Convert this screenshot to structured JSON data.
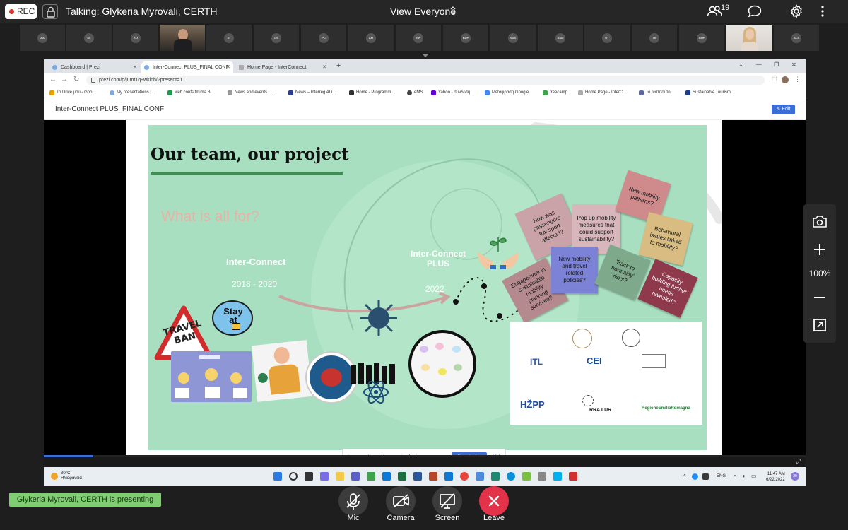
{
  "topbar": {
    "rec_label": "REC",
    "talking": "Talking: Glykeria Myrovali, CERTH",
    "view_mode": "View Everyone",
    "participant_count": "19"
  },
  "thumbnails": [
    {
      "initials": "AA"
    },
    {
      "initials": "KL"
    },
    {
      "initials": "KO"
    },
    {
      "initials": ""
    },
    {
      "initials": "JT"
    },
    {
      "initials": "DS"
    },
    {
      "initials": "PC"
    },
    {
      "initials": "AM"
    },
    {
      "initials": "GK"
    },
    {
      "initials": "BDP"
    },
    {
      "initials": "VDS"
    },
    {
      "initials": "ASM"
    },
    {
      "initials": "GT"
    },
    {
      "initials": "TM"
    },
    {
      "initials": "SMP"
    },
    {
      "initials": ""
    },
    {
      "initials": "ALS"
    }
  ],
  "browser": {
    "tabs": [
      {
        "label": "Dashboard | Prezi"
      },
      {
        "label": "Inter-Connect PLUS_FINAL CONF"
      },
      {
        "label": "Home Page - InterConnect"
      }
    ],
    "url": "prezi.com/p/jumt1q9wklnh/?present=1",
    "bookmarks": [
      "To Drive μου - Goo...",
      "My presentations |...",
      "web confs tmima B...",
      "News and events | I...",
      "News – Interreg AD...",
      "Home - Programm...",
      "eMS",
      "Yahoo - σύνδεση",
      "Μετάφραση Google",
      "freecamp",
      "Home Page - InterC...",
      "Το Ινστιτούτο",
      "Sustainable Tourism..."
    ]
  },
  "prezi": {
    "title": "Inter-Connect PLUS_FINAL CONF",
    "edit_label": "Edit"
  },
  "slide": {
    "heading": "Our team, our project",
    "question": "What is all for?",
    "ic_label": "Inter-Connect",
    "ic_years": "2018 - 2020",
    "icp_label": "Inter-Connect PLUS",
    "icp_year": "2022",
    "travel_ban": "TRAVEL BAN",
    "stay_home": "Stay at",
    "stickies": [
      {
        "text": "How was passengers transport affected?",
        "color": "#c9a3a8"
      },
      {
        "text": "Pop up mobility measures that could support sustainability?",
        "color": "#d8b7bc"
      },
      {
        "text": "New mobility patterns?",
        "color": "#cf8a8c"
      },
      {
        "text": "Behavioral issues linked to mobility?",
        "color": "#d8bc82"
      },
      {
        "text": "Engagement in sustainable mobility planning survived?",
        "color": "#b48a8e"
      },
      {
        "text": "New mobility and travel related policies?",
        "color": "#7c83d6"
      },
      {
        "text": "'Back to normality' risks?",
        "color": "#7fa98b"
      },
      {
        "text": "Capacity building further needs revealed?",
        "color": "#8e3a4c"
      }
    ],
    "logos": [
      "ITL",
      "CEI",
      "HŽPP",
      "RRA LUR",
      "RegioneEmiliaRomagna"
    ]
  },
  "share": {
    "message": "app.gotomeeting.com is sharing your screen.",
    "stop_label": "Stop sharing",
    "hide_label": "Hide"
  },
  "taskbar": {
    "temp": "30°C",
    "weather": "Ηλιοφάνεια",
    "lang": "ENG",
    "time": "11:47 AM",
    "date": "6/22/2022",
    "badge": "20"
  },
  "zoom": {
    "level": "100%"
  },
  "bottom": {
    "presenting": "Glykeria Myrovali, CERTH is presenting",
    "mic_label": "Mic",
    "camera_label": "Camera",
    "screen_label": "Screen",
    "leave_label": "Leave"
  },
  "colors": {
    "accent": "#3a6ed6",
    "leave": "#e3334a",
    "presenting": "#7fcf72",
    "rec_dot": "#e0322e",
    "slide_bg": "#a8dfc0"
  }
}
